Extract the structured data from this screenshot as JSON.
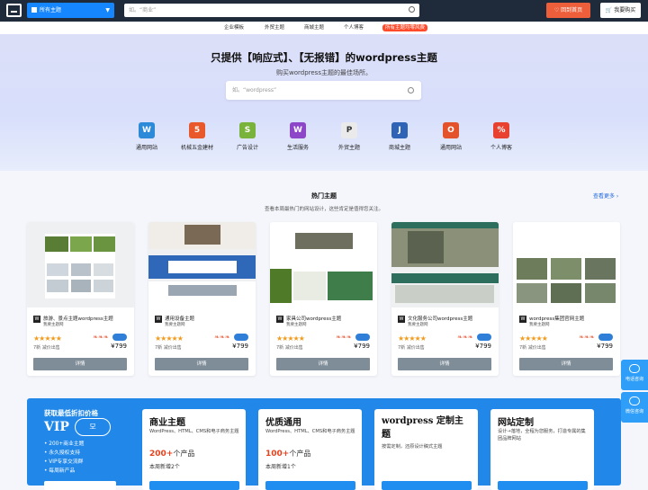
{
  "topbar": {
    "category": "所有主题",
    "search_placeholder": "如。“商业”",
    "back_button": "回到首页",
    "buy_button": "我要购买"
  },
  "subnav": {
    "items": [
      "企业模板",
      "外贸主题",
      "商城主题",
      "个人博客"
    ],
    "badge": "所有主题均零风费"
  },
  "hero": {
    "title": "只提供【响应式】、【无报错】的wordpress主题",
    "subtitle": "购买wordpress主题的最佳场所。",
    "search_placeholder": "如。“wordpress”"
  },
  "categories": [
    {
      "label": "通用网站",
      "icon": "wordpress-icon",
      "color": "#2c8ad9",
      "glyph": "W"
    },
    {
      "label": "机械五金建材",
      "icon": "html5-icon",
      "color": "#e9582a",
      "glyph": "5"
    },
    {
      "label": "广告设计",
      "icon": "shopify-icon",
      "color": "#7ab33c",
      "glyph": "S"
    },
    {
      "label": "生活服务",
      "icon": "woo-icon",
      "color": "#8d46c7",
      "glyph": "W"
    },
    {
      "label": "外贸主题",
      "icon": "prestashop-icon",
      "color": "#eaeaea",
      "glyph": "P"
    },
    {
      "label": "商城主题",
      "icon": "joomla-icon",
      "color": "#2f63b5",
      "glyph": "J"
    },
    {
      "label": "通用网站",
      "icon": "opencart-icon",
      "color": "#e3522a",
      "glyph": "O"
    },
    {
      "label": "个人博客",
      "icon": "percent-icon",
      "color": "#e8412f",
      "glyph": "%"
    }
  ],
  "hot": {
    "title": "热门主题",
    "subtitle": "查看本周最热门的网站设计，这些肯定是值得您关注。",
    "more": "查看更多 ›"
  },
  "cards": [
    {
      "name": "旅游、景点主题wordpress主题",
      "author": "我要主题网",
      "meta": "7新  减价出售",
      "price": "¥799",
      "details": "详情"
    },
    {
      "name": "通用设备主题",
      "author": "我要主题网",
      "meta": "7新  减价出售",
      "price": "¥799",
      "details": "详情"
    },
    {
      "name": "家具公司wordpress主题",
      "author": "我要主题网",
      "meta": "7新  减价出售",
      "price": "¥799",
      "details": "详情"
    },
    {
      "name": "文化服务公司wordpress主题",
      "author": "我要主题网",
      "meta": "7新  减价出售",
      "price": "¥799",
      "details": "详情"
    },
    {
      "name": "wordpress集团官网主题",
      "author": "我要主题网",
      "meta": "7新  减价出售",
      "price": "¥799",
      "details": "详情"
    }
  ],
  "float": {
    "online": "电话咨询",
    "wechat": "微信咨询"
  },
  "promo": {
    "title": "获取最低折扣价格",
    "vip": "VIP",
    "perks": [
      "200+商业主题",
      "永久授权支持",
      "VIP专享交流群",
      "每周新产品"
    ]
  },
  "promo_cards": [
    {
      "head": "商业主题",
      "desc": "WordPress、HTML、CMS和电子商务主题",
      "count": "200+",
      "count_suffix": "个产品",
      "new": "本周新增2个"
    },
    {
      "head": "优质通用",
      "desc": "WordPress、HTML、CMS和电子商务主题",
      "count": "100+",
      "count_suffix": "个产品",
      "new": "本周新增1个"
    },
    {
      "head": "wordpress 定制主题",
      "desc": "按需定制，还原设计稿式主题",
      "count": "",
      "count_suffix": "",
      "new": ""
    },
    {
      "head": "网站定制",
      "desc": "设计→落地，全程为您服务，打造专属的集团品牌网站",
      "count": "",
      "count_suffix": "",
      "new": ""
    }
  ]
}
